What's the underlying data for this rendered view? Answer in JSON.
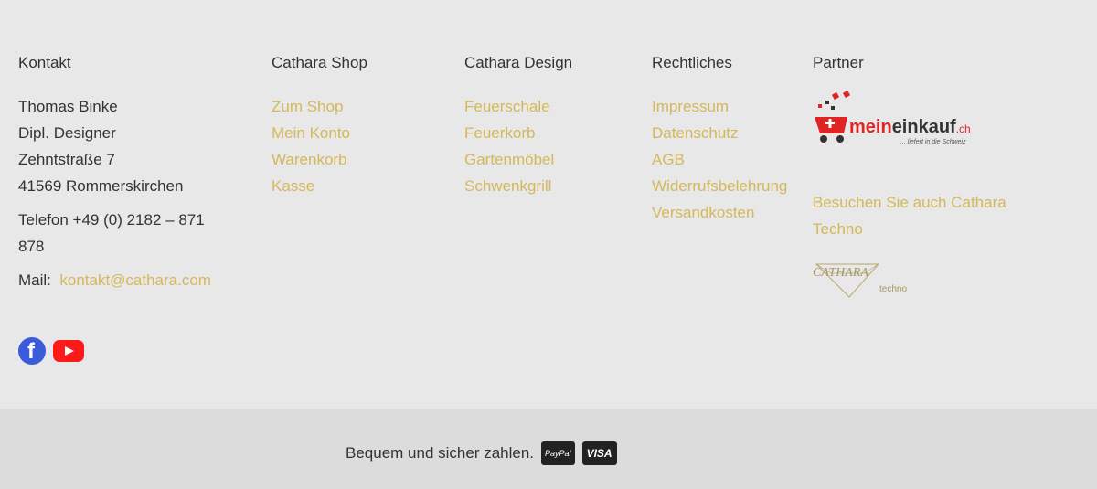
{
  "kontakt": {
    "heading": "Kontakt",
    "name": "Thomas Binke",
    "title": "Dipl. Designer",
    "street": "Zehntstraße 7",
    "city": "41569 Rommerskirchen",
    "phone_line1": "Telefon +49 (0) 2182 – 871",
    "phone_line2": "878",
    "mail_label": "Mail:",
    "mail": "kontakt@cathara.com"
  },
  "shop": {
    "heading": "Cathara Shop",
    "links": [
      "Zum Shop",
      "Mein Konto",
      "Warenkorb",
      "Kasse"
    ]
  },
  "design": {
    "heading": "Cathara Design",
    "links": [
      "Feuerschale",
      "Feuerkorb",
      "Gartenmöbel",
      "Schwenkgrill"
    ]
  },
  "legal": {
    "heading": "Rechtliches",
    "links": [
      "Impressum",
      "Datenschutz",
      "AGB",
      "Widerrufsbelehrung",
      "Versandkosten"
    ]
  },
  "partner": {
    "heading": "Partner",
    "logo_text": "meineinkauf",
    "logo_suffix": ".ch",
    "logo_tagline": "... liefert in die Schweiz",
    "visit_line1": "Besuchen Sie auch Cathara",
    "visit_line2": "Techno",
    "techno_logo_main": "CATHARA",
    "techno_logo_sub": "techno"
  },
  "social": {
    "icons": [
      "facebook-icon",
      "youtube-icon"
    ]
  },
  "payment": {
    "text": "Bequem und sicher zahlen.",
    "methods": [
      "PayPal",
      "VISA"
    ]
  },
  "colors": {
    "link": "#d4b85a",
    "text": "#333333",
    "bg": "#e8e8e8",
    "bottom_bg": "#dcdcdc"
  }
}
